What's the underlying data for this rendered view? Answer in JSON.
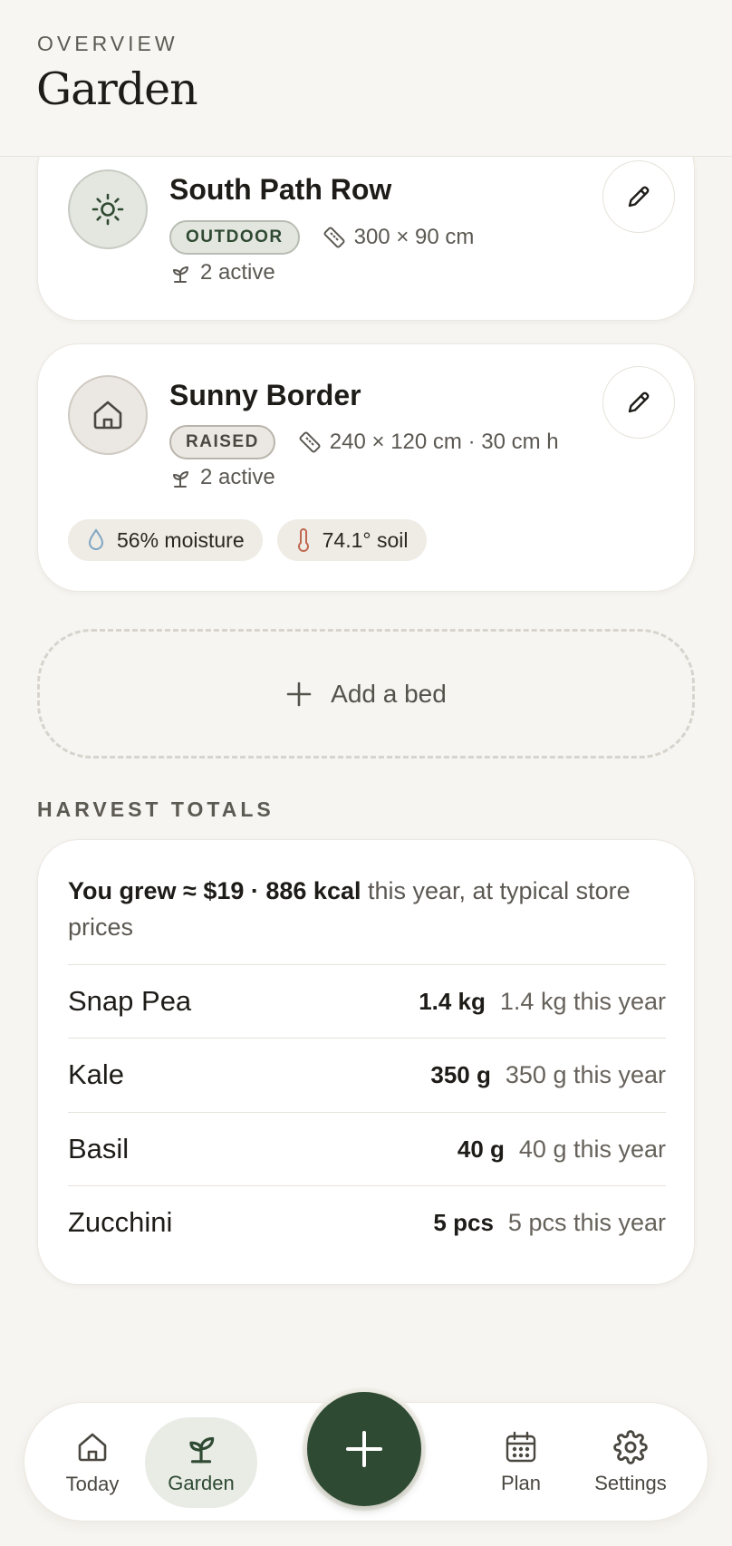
{
  "header": {
    "eyebrow": "OVERVIEW",
    "title": "Garden"
  },
  "beds": [
    {
      "name": "South Path Row",
      "type_badge": "OUTDOOR",
      "dimensions": "300 × 90 cm",
      "active": "2 active",
      "icon": "sun-icon"
    },
    {
      "name": "Sunny Border",
      "type_badge": "RAISED",
      "dimensions": "240 × 120 cm · 30 cm h",
      "active": "2 active",
      "icon": "house-icon",
      "moisture": "56% moisture",
      "soil": "74.1° soil"
    }
  ],
  "add_bed_label": "Add a bed",
  "harvest": {
    "section_label": "HARVEST TOTALS",
    "summary_bold": "You grew ≈ $19 · 886 kcal",
    "summary_rest": " this year, at typical store prices",
    "rows": [
      {
        "crop": "Snap Pea",
        "amount": "1.4 kg",
        "year": "1.4 kg this year"
      },
      {
        "crop": "Kale",
        "amount": "350 g",
        "year": "350 g this year"
      },
      {
        "crop": "Basil",
        "amount": "40 g",
        "year": "40 g this year"
      },
      {
        "crop": "Zucchini",
        "amount": "5 pcs",
        "year": "5 pcs this year"
      }
    ]
  },
  "nav": {
    "today": "Today",
    "garden": "Garden",
    "plan": "Plan",
    "settings": "Settings"
  },
  "colors": {
    "accent": "#2f4a32",
    "background": "#f7f5f1",
    "card": "#ffffff",
    "moisture_icon": "#7fa6c2",
    "soil_icon": "#c0684f"
  }
}
